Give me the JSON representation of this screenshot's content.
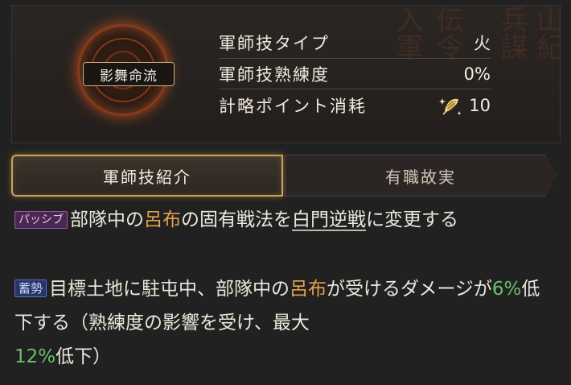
{
  "skill": {
    "name": "影舞命流"
  },
  "stats": [
    {
      "label": "軍師技タイプ",
      "value": "火"
    },
    {
      "label": "軍師技熟練度",
      "value": "0%"
    },
    {
      "label": "計略ポイント消耗",
      "value": "10",
      "icon": "feather-icon"
    }
  ],
  "tabs": {
    "intro": "軍師技紹介",
    "history": "有職故実"
  },
  "description": {
    "passive": {
      "badge": "パッシブ",
      "t1": "部隊中の",
      "name": "呂布",
      "t2": "の固有戦法を",
      "tactic": "白門逆戦",
      "t3": "に変更する"
    },
    "charge": {
      "badge": "蓄勢",
      "t1": "目標土地に駐屯中、部隊中の",
      "name": "呂布",
      "t2": "が受けるダメージが",
      "pct1": "6%",
      "t3": "低下する（熟練度の影響を受け、最大",
      "pct2": "12%",
      "t4": "低下）"
    }
  },
  "colors": {
    "accent_gold": "#c9a35a",
    "name_orange": "#e3a24e",
    "value_green": "#6dbf6a",
    "passive_badge": "#4a2752",
    "charge_badge": "#27346a"
  }
}
